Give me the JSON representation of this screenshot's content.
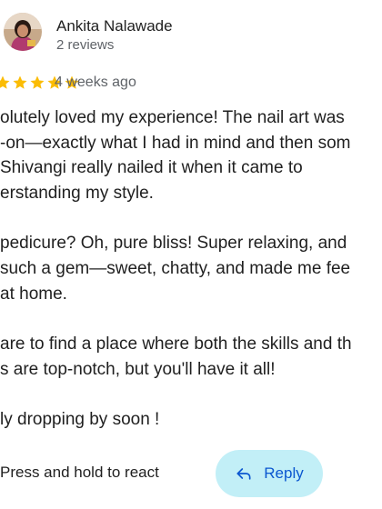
{
  "review": {
    "author": "Ankita Nalawade",
    "review_count": "2 reviews",
    "rating": 5,
    "date": "4 weeks ago",
    "text_lines": [
      "olutely loved my experience! The nail art was",
      "-on—exactly what I had in mind and then som",
      "Shivangi really nailed it when it came to",
      "erstanding my style.",
      "pedicure? Oh, pure bliss! Super relaxing, and",
      "such a gem—sweet, chatty, and made me fee",
      " at home.",
      "are to find a place where both the skills and th",
      "s are top-notch, but you'll have it all!",
      "ly dropping by soon !"
    ]
  },
  "actions": {
    "react_hint": "Press and hold to react",
    "reply_label": "Reply"
  },
  "colors": {
    "star": "#fbbc04",
    "reply_bg": "#c2eff7",
    "reply_text": "#0b57d0",
    "secondary_text": "#5f6368"
  },
  "icons": {
    "avatar": "user-photo",
    "star": "star-icon",
    "reply": "reply-arrow-icon"
  }
}
